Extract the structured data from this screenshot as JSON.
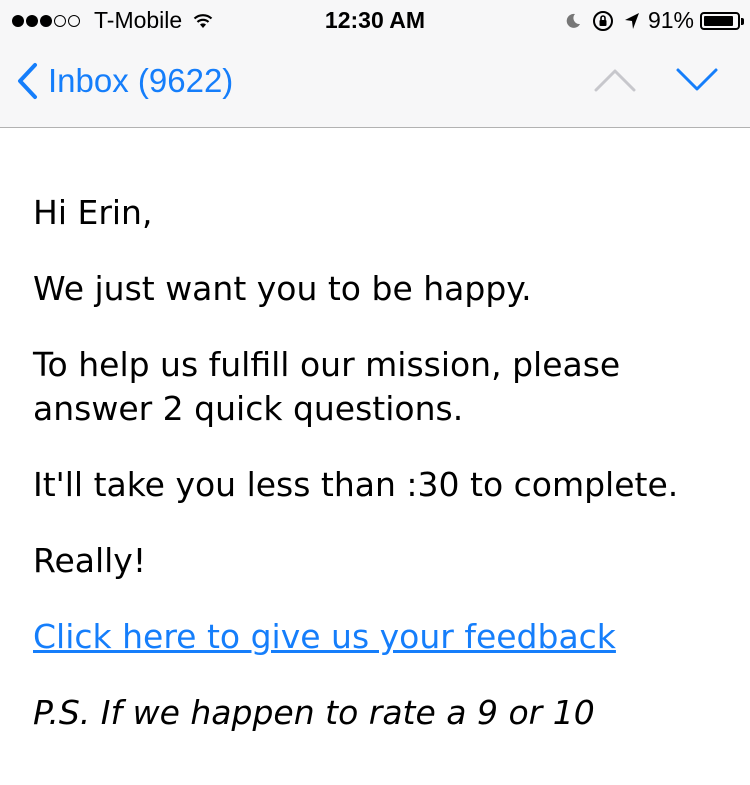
{
  "status_bar": {
    "carrier": "T-Mobile",
    "time": "12:30 AM",
    "battery_percent": "91%",
    "battery_level": 0.91,
    "signal_bars_filled": 3,
    "signal_bars_total": 5,
    "icons": [
      "wifi-icon",
      "moon-icon",
      "rotation-lock-icon",
      "location-icon",
      "battery-icon"
    ]
  },
  "nav_bar": {
    "back_label": "Inbox (9622)",
    "colors": {
      "accent": "#157efb",
      "disabled": "#c7c7cc"
    }
  },
  "email": {
    "greeting": "Hi Erin,",
    "paragraphs": [
      "We just want you to be happy.",
      "To help us fulfill our mission, please answer 2 quick questions.",
      "It'll take you less than :30 to complete.",
      "Really!"
    ],
    "link_text": "Click here to give us your feedback",
    "ps_partial": "P.S. If we happen to rate a 9 or 10"
  }
}
